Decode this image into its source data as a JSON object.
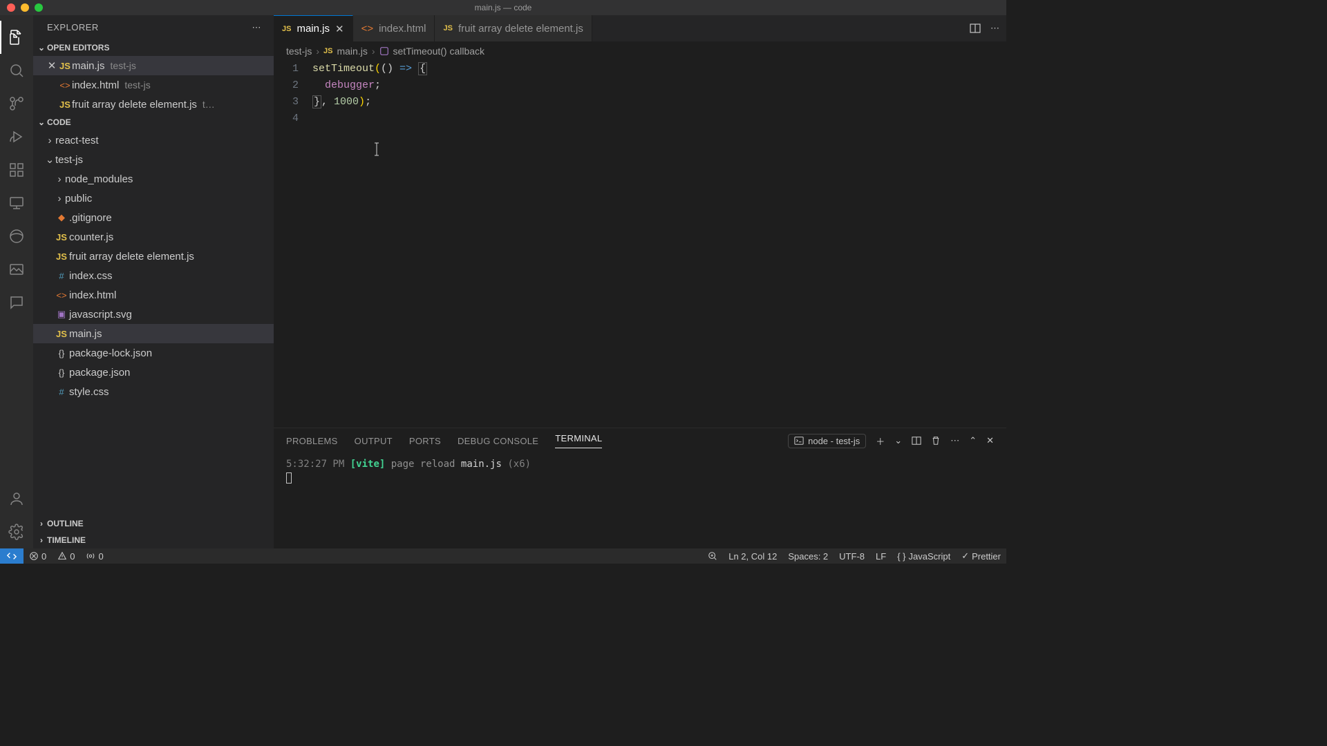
{
  "window": {
    "title": "main.js — code"
  },
  "explorer": {
    "title": "EXPLORER",
    "sections": {
      "open_editors": "OPEN EDITORS",
      "code": "CODE",
      "outline": "OUTLINE",
      "timeline": "TIMELINE"
    },
    "open_editors": [
      {
        "name": "main.js",
        "dir": "test-js",
        "icon": "js",
        "active": true
      },
      {
        "name": "index.html",
        "dir": "test-js",
        "icon": "html",
        "active": false
      },
      {
        "name": "fruit array delete element.js",
        "dir": "t…",
        "icon": "js",
        "active": false
      }
    ],
    "folders": [
      {
        "name": "react-test",
        "depth": 0,
        "expanded": false
      },
      {
        "name": "test-js",
        "depth": 0,
        "expanded": true
      },
      {
        "name": "node_modules",
        "depth": 1,
        "expanded": false
      },
      {
        "name": "public",
        "depth": 1,
        "expanded": false
      }
    ],
    "files": [
      {
        "name": ".gitignore",
        "icon": "git"
      },
      {
        "name": "counter.js",
        "icon": "js"
      },
      {
        "name": "fruit array delete element.js",
        "icon": "js"
      },
      {
        "name": "index.css",
        "icon": "hash"
      },
      {
        "name": "index.html",
        "icon": "html"
      },
      {
        "name": "javascript.svg",
        "icon": "svg"
      },
      {
        "name": "main.js",
        "icon": "js",
        "selected": true
      },
      {
        "name": "package-lock.json",
        "icon": "json"
      },
      {
        "name": "package.json",
        "icon": "json"
      },
      {
        "name": "style.css",
        "icon": "hash"
      }
    ]
  },
  "tabs": [
    {
      "name": "main.js",
      "icon": "js",
      "active": true
    },
    {
      "name": "index.html",
      "icon": "html",
      "active": false
    },
    {
      "name": "fruit array delete element.js",
      "icon": "js",
      "active": false
    }
  ],
  "breadcrumbs": {
    "parts": [
      "test-js",
      "main.js",
      "setTimeout() callback"
    ]
  },
  "code": {
    "lines": [
      "1",
      "2",
      "3",
      "4"
    ],
    "l1_fn": "setTimeout",
    "l1_rest": "(() ",
    "l1_arrow": "=>",
    "l1_brace": " {",
    "l2_indent": "  ",
    "l2_kw": "debugger",
    "l2_semi": ";",
    "l3_close": "}",
    "l3_rest": ", ",
    "l3_num": "1000",
    "l3_end": ");"
  },
  "panel": {
    "tabs": [
      "PROBLEMS",
      "OUTPUT",
      "PORTS",
      "DEBUG CONSOLE",
      "TERMINAL"
    ],
    "active_tab": "TERMINAL",
    "terminal_selector": "node - test-js",
    "terminal": {
      "time": "5:32:27 PM",
      "vite": "[vite]",
      "msg1": "page reload",
      "file": "main.js",
      "count": "(x6)"
    }
  },
  "status": {
    "errors": "0",
    "warnings": "0",
    "ports": "0",
    "cursor": "Ln 2, Col 12",
    "spaces": "Spaces: 2",
    "encoding": "UTF-8",
    "eol": "LF",
    "lang": "JavaScript",
    "prettier": "Prettier"
  }
}
